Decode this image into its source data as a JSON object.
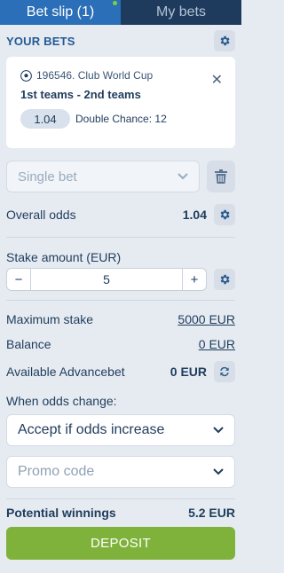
{
  "tabs": [
    {
      "label": "Bet slip (1)"
    },
    {
      "label": "My bets"
    }
  ],
  "header": {
    "title": "YOUR BETS"
  },
  "bet": {
    "event": "196546. Club World Cup",
    "teams": "1st teams - 2nd teams",
    "odds": "1.04",
    "type": "Double Chance: 12"
  },
  "bet_type_select": {
    "value": "Single bet"
  },
  "overall_odds": {
    "label": "Overall odds",
    "value": "1.04"
  },
  "stake": {
    "label": "Stake amount (EUR)",
    "minus": "−",
    "value": "5",
    "plus": "+"
  },
  "max_stake": {
    "label": "Maximum stake",
    "value": "5000 EUR"
  },
  "balance": {
    "label": "Balance",
    "value": "0 EUR"
  },
  "advancebet": {
    "label": "Available Advancebet",
    "value": "0 EUR"
  },
  "odds_change": {
    "label": "When odds change:",
    "value": "Accept if odds increase"
  },
  "promo": {
    "placeholder": "Promo code"
  },
  "winnings": {
    "label": "Potential winnings",
    "value": "5.2 EUR"
  },
  "deposit": {
    "label": "DEPOSIT"
  },
  "colors": {
    "accent": "#2a6fb8",
    "nav": "#1e3b5e",
    "deposit": "#7fb23b",
    "badge": "#7bd142"
  }
}
